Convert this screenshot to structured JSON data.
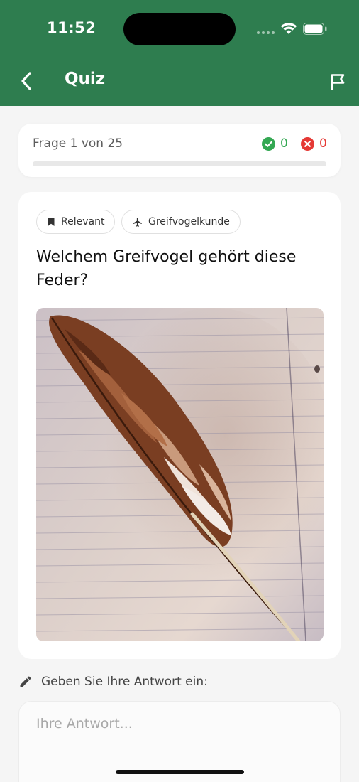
{
  "status_bar": {
    "time": "11:52"
  },
  "header": {
    "title": "Quiz",
    "back_icon": "chevron-left-icon",
    "flag_icon": "flag-icon"
  },
  "progress": {
    "label": "Frage 1 von 25",
    "correct_count": "0",
    "wrong_count": "0",
    "fraction": 0.0,
    "colors": {
      "correct": "#34a853",
      "wrong": "#e53935",
      "accent": "#2e7d4f"
    }
  },
  "question": {
    "tags": [
      {
        "label": "Relevant",
        "icon": "bookmark-icon"
      },
      {
        "label": "Greifvogelkunde",
        "icon": "airplane-icon"
      }
    ],
    "text": "Welchem Greifvogel gehört diese Feder?",
    "image": "feather-photo"
  },
  "answer": {
    "label": "Geben Sie Ihre Antwort ein:",
    "label_icon": "pencil-icon",
    "placeholder": "Ihre Antwort..."
  }
}
